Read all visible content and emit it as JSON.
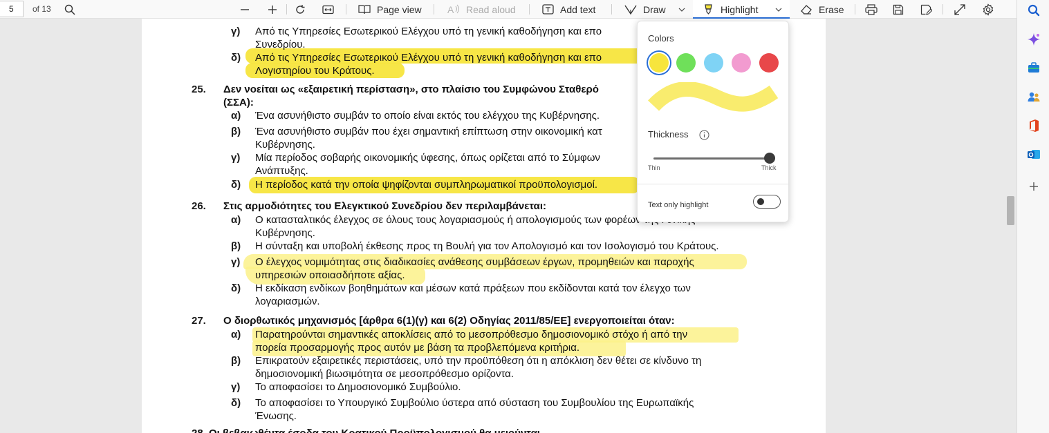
{
  "toolbar": {
    "page_number": "5",
    "page_total": "of 13",
    "page_view_label": "Page view",
    "read_aloud_label": "Read aloud",
    "add_text_label": "Add text",
    "draw_label": "Draw",
    "highlight_label": "Highlight",
    "erase_label": "Erase"
  },
  "popup": {
    "colors_title": "Colors",
    "colors": [
      "#f7e53d",
      "#6fe05a",
      "#7fd3f5",
      "#f29bd0",
      "#e8474a"
    ],
    "selected_color": "#f7e53d",
    "thickness_title": "Thickness",
    "thin_label": "Thin",
    "thick_label": "Thick",
    "thickness_level": 1.0,
    "text_only_label": "Text only highlight",
    "text_only_enabled": false
  },
  "document": {
    "q24_g_a": "Από τις Υπηρεσίες Εσωτερικού Ελέγχου υπό τη γενική καθοδήγηση και επο",
    "q24_g_b": "Συνεδρίου.",
    "q24_d_a": "Από τις  Υπηρεσίες Εσωτερικού Ελέγχου υπό τη γενική καθοδήγηση και επο",
    "q24_d_b": "Λογιστηρίου του Κράτους.",
    "q25_num": "25.",
    "q25_a": "Δεν νοείται ως «εξαιρετική περίσταση», στο πλαίσιο του Συμφώνου Σταθερό",
    "q25_b": "(ΣΣΑ):",
    "q25_alpha": "Ένα ασυνήθιστο συμβάν το οποίο είναι εκτός του ελέγχου της Κυβέρνησης.",
    "q25_beta_a": "Ένα ασυνήθιστο συμβάν που έχει σημαντική επίπτωση στην οικονομική κατ",
    "q25_beta_b": "Κυβέρνησης.",
    "q25_gamma_a": "Μία περίοδος σοβαρής οικονομικής ύφεσης, όπως ορίζεται από το Σύμφων",
    "q25_gamma_b": "Ανάπτυξης.",
    "q25_delta": "Η περίοδος κατά την οποία ψηφίζονται συμπληρωματικοί προϋπολογισμοί.",
    "q26_num": "26.",
    "q26_title": "Στις αρμοδιότητες του Ελεγκτικού Συνεδρίου δεν περιλαμβάνεται:",
    "q26_alpha_a": "Ο κατασταλτικός έλεγχος σε όλους τους λογαριασμούς ή απολογισμούς των φορέων της Γενικής",
    "q26_alpha_b": "Κυβέρνησης.",
    "q26_beta": "Η σύνταξη και υποβολή έκθεσης προς τη Βουλή για τον Απολογισμό και τον Ισολογισμό του Κράτους.",
    "q26_gamma_a": "Ο έλεγχος νομιμότητας στις διαδικασίες ανάθεσης συμβάσεων έργων, προμηθειών και παροχής",
    "q26_gamma_b": "υπηρεσιών οποιασδήποτε αξίας.",
    "q26_delta_a": "Η εκδίκαση ενδίκων βοηθημάτων και μέσων κατά πράξεων που εκδίδονται κατά τον έλεγχο των",
    "q26_delta_b": "λογαριασμών.",
    "q27_num": "27.",
    "q27_title": "Ο διορθωτικός μηχανισμός  [άρθρα 6(1)(γ) και 6(2) Οδηγίας 2011/85/ΕΕ] ενεργοποιείται όταν:",
    "q27_alpha_a": "Παρατηρούνται σημαντικές αποκλίσεις από το μεσοπρόθεσμο δημοσιονομικό στόχο ή από την",
    "q27_alpha_b": "πορεία προσαρμογής προς αυτόν με βάση τα προβλεπόμενα κριτήρια.",
    "q27_beta_a": "Επικρατούν εξαιρετικές περιστάσεις, υπό την προϋπόθεση ότι η απόκλιση δεν θέτει σε κίνδυνο τη",
    "q27_beta_b": "δημοσιονομική βιωσιμότητα σε μεσοπρόθεσμο ορίζοντα.",
    "q27_gamma": "Το αποφασίσει το Δημοσιονομικό Συμβούλιο.",
    "q27_delta_a": "Το αποφασίσει το Υπουργικό Συμβούλιο ύστερα από σύσταση του Συμβουλίου της Ευρωπαϊκής",
    "q27_delta_b": "Ένωσης.",
    "q28_partial": "28.    Οι βεβαιωθέντα έσοδα του Κρατικού Προϋπολογισμού θα μειούνται",
    "letters": {
      "alpha": "α)",
      "beta": "β)",
      "gamma": "γ)",
      "delta": "δ)"
    }
  }
}
